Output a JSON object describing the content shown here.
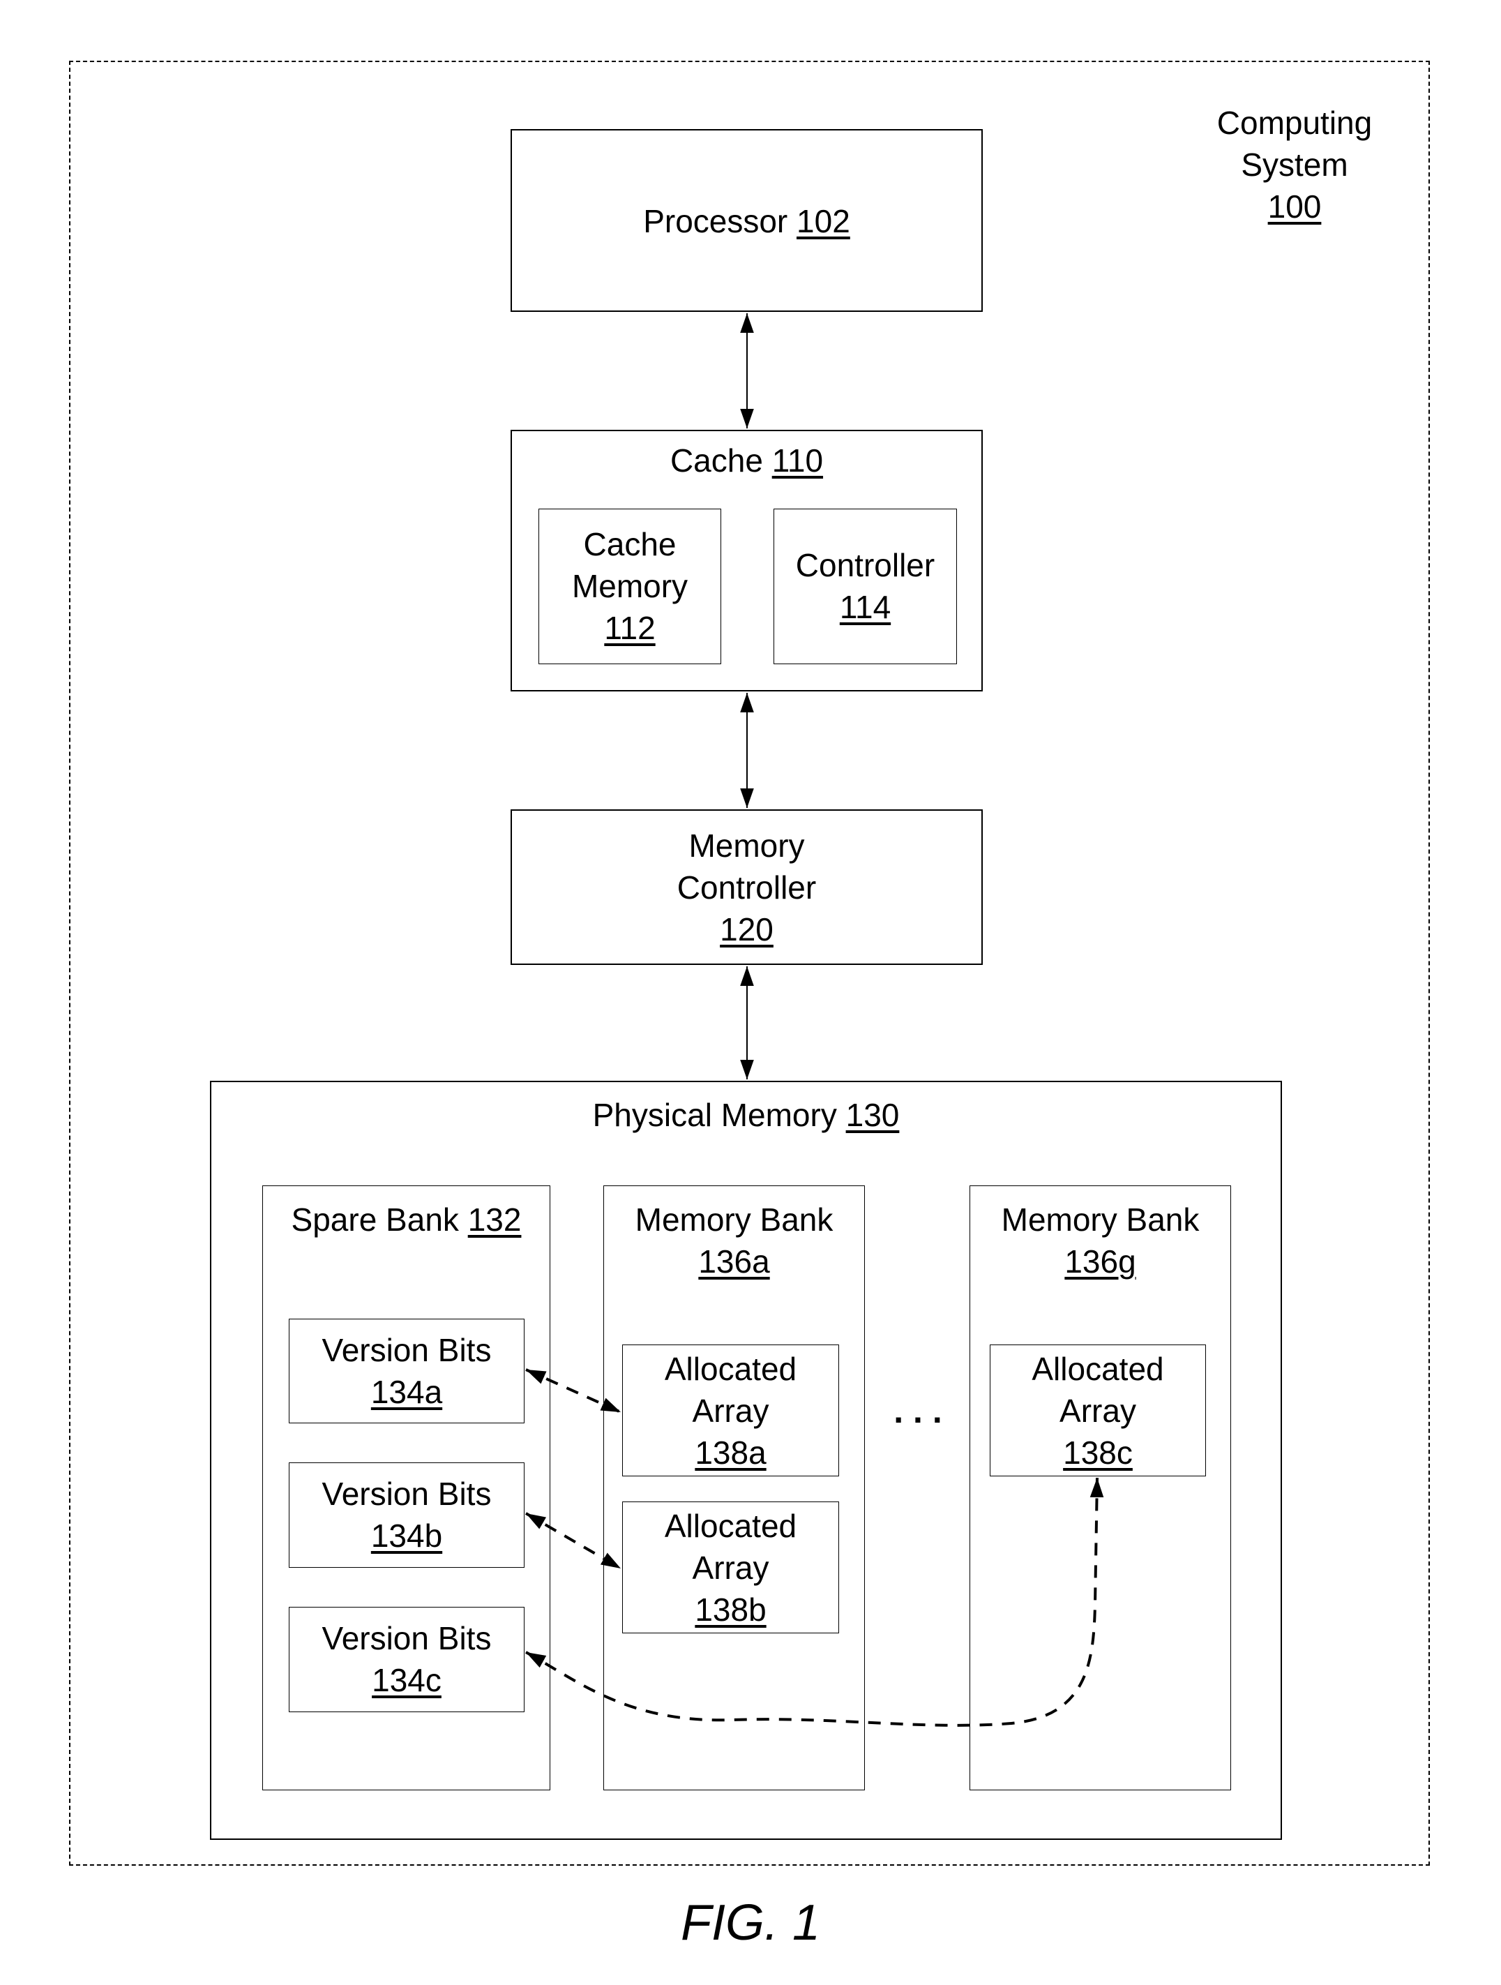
{
  "figure_label": "FIG. 1",
  "computing_system": {
    "name_line1": "Computing",
    "name_line2": "System",
    "ref": "100"
  },
  "processor": {
    "name": "Processor",
    "ref": "102"
  },
  "cache": {
    "name": "Cache",
    "ref": "110",
    "cache_memory": {
      "line1": "Cache",
      "line2": "Memory",
      "ref": "112"
    },
    "controller": {
      "name": "Controller",
      "ref": "114"
    }
  },
  "memory_controller": {
    "line1": "Memory",
    "line2": "Controller",
    "ref": "120"
  },
  "physical_memory": {
    "name": "Physical Memory",
    "ref": "130",
    "spare_bank": {
      "name": "Spare Bank",
      "ref": "132",
      "version_bits": [
        {
          "name": "Version Bits",
          "ref": "134a"
        },
        {
          "name": "Version Bits",
          "ref": "134b"
        },
        {
          "name": "Version Bits",
          "ref": "134c"
        }
      ]
    },
    "memory_banks": [
      {
        "name": "Memory Bank",
        "ref": "136a",
        "arrays": [
          {
            "line1": "Allocated",
            "line2": "Array",
            "ref": "138a"
          },
          {
            "line1": "Allocated",
            "line2": "Array",
            "ref": "138b"
          }
        ]
      },
      {
        "name": "Memory Bank",
        "ref": "136g",
        "arrays": [
          {
            "line1": "Allocated",
            "line2": "Array",
            "ref": "138c"
          }
        ]
      }
    ],
    "ellipsis": ". . ."
  },
  "connections": [
    {
      "from": "processor-102",
      "to": "cache-110",
      "style": "solid",
      "direction": "bidirectional"
    },
    {
      "from": "cache-110",
      "to": "memory-controller-120",
      "style": "solid",
      "direction": "bidirectional"
    },
    {
      "from": "memory-controller-120",
      "to": "physical-memory-130",
      "style": "solid",
      "direction": "bidirectional"
    },
    {
      "from": "version-bits-134a",
      "to": "allocated-array-138a",
      "style": "dashed",
      "direction": "bidirectional"
    },
    {
      "from": "version-bits-134b",
      "to": "allocated-array-138b",
      "style": "dashed",
      "direction": "bidirectional"
    },
    {
      "from": "version-bits-134c",
      "to": "allocated-array-138c",
      "style": "dashed-curved",
      "direction": "bidirectional"
    }
  ]
}
